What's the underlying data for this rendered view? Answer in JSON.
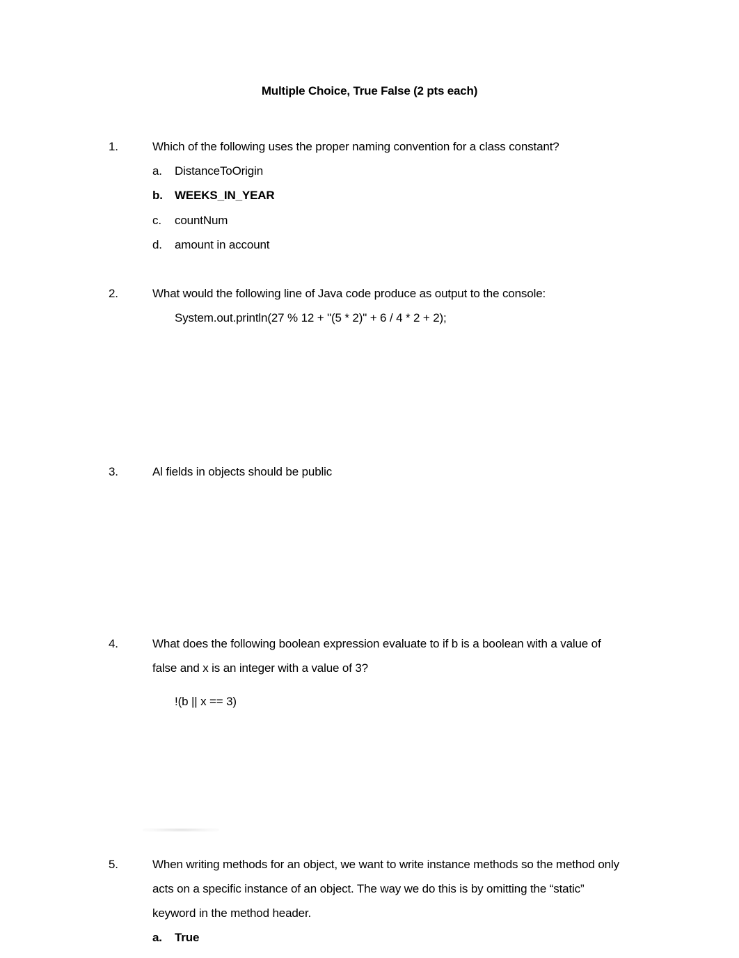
{
  "document": {
    "title": "Multiple Choice, True False (2 pts each)",
    "questions": [
      {
        "number": "1.",
        "text_lines": [
          "Which of the following uses the proper naming convention for a class constant?"
        ],
        "options": [
          {
            "letter": "a.",
            "text": "DistanceToOrigin",
            "bold": false
          },
          {
            "letter": "b.",
            "text": "WEEKS_IN_YEAR",
            "bold": true
          },
          {
            "letter": "c.",
            "text": "countNum",
            "bold": false
          },
          {
            "letter": "d.",
            "text": "amount in account",
            "bold": false
          }
        ]
      },
      {
        "number": "2.",
        "text_lines": [
          "What would the following line of Java code produce as output to the console:"
        ],
        "code": "System.out.println(27 % 12 + \"(5 * 2)\" + 6 / 4 * 2 + 2);"
      },
      {
        "number": "3.",
        "text_lines": [
          "Al fields in objects should be public"
        ]
      },
      {
        "number": "4.",
        "text_lines": [
          "What does the following boolean expression evaluate to if b is a boolean with a value of",
          "false and x is an integer with a value of 3?"
        ],
        "code": "!(b || x == 3)"
      },
      {
        "number": "5.",
        "text_lines": [
          "When writing methods for an object, we want to write instance methods so the method only",
          "acts on a specific instance of an object. The way we do this is by omitting the “static”",
          "keyword in the method header."
        ],
        "options": [
          {
            "letter": "a.",
            "text": "True",
            "bold": true
          }
        ]
      }
    ]
  }
}
